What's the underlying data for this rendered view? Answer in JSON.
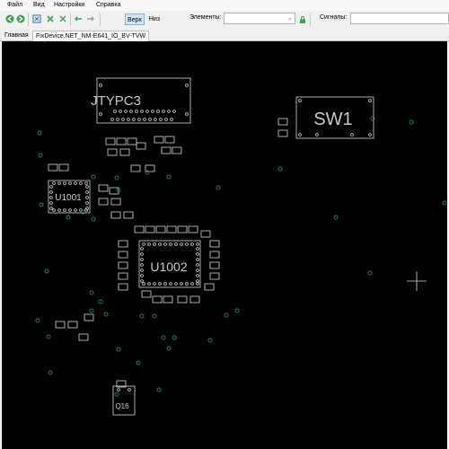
{
  "menu": {
    "file": "Файл",
    "view": "Вид",
    "settings": "Настройки",
    "help": "Справка"
  },
  "toolbar": {
    "side_top": "Верх",
    "side_bottom": "Низ",
    "elements_label": "Элементы:",
    "elements_value": "",
    "signals_label": "Сигналы:",
    "signals_value": ""
  },
  "tabs": [
    {
      "label": "Главная"
    },
    {
      "label": "FixDevice.NET_NM-E641_IO_BV-TVW"
    }
  ],
  "board": {
    "components": {
      "jtypc3": "JTYPC3",
      "sw1": "SW1",
      "u1001": "U1001",
      "u1002": "U1002",
      "q16": "Q16"
    }
  },
  "colors": {
    "canvas_bg": "#000000",
    "outline": "#d8d8d8",
    "via": "#1e8a4a",
    "text": "#c8c8c8",
    "active_tab_border": "#7eb4ea"
  }
}
